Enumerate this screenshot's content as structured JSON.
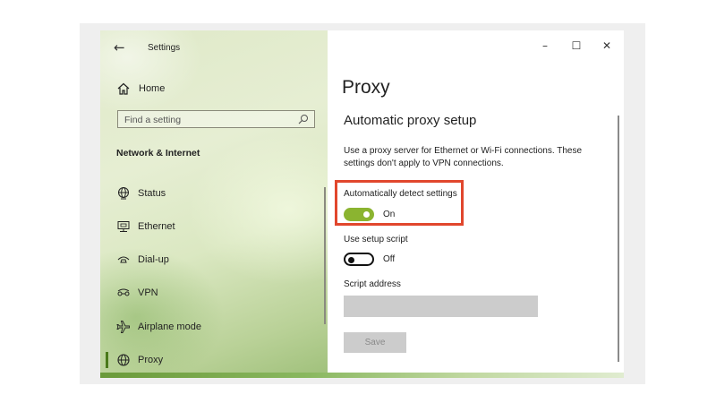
{
  "window": {
    "app_title": "Settings",
    "controls": {
      "minimize": "–",
      "maximize": "☐",
      "close": "✕"
    }
  },
  "sidebar": {
    "home_label": "Home",
    "search_placeholder": "Find a setting",
    "section_header": "Network & Internet",
    "items": [
      {
        "label": "Status",
        "icon": "globe-status-icon"
      },
      {
        "label": "Ethernet",
        "icon": "ethernet-monitor-icon"
      },
      {
        "label": "Dial-up",
        "icon": "dialup-phone-icon"
      },
      {
        "label": "VPN",
        "icon": "vpn-icon"
      },
      {
        "label": "Airplane mode",
        "icon": "airplane-icon"
      },
      {
        "label": "Proxy",
        "icon": "globe-proxy-icon",
        "selected": true
      }
    ]
  },
  "main": {
    "page_title": "Proxy",
    "section_title": "Automatic proxy setup",
    "description": "Use a proxy server for Ethernet or Wi-Fi connections. These settings don't apply to VPN connections.",
    "auto_detect": {
      "label": "Automatically detect settings",
      "state": "On",
      "on": true
    },
    "setup_script": {
      "label": "Use setup script",
      "state": "Off",
      "on": false
    },
    "script_address": {
      "label": "Script address",
      "value": ""
    },
    "save_label": "Save"
  },
  "colors": {
    "toggle_on": "#8bb430",
    "highlight_border": "#e1472d",
    "sidebar_selected": "#4a7a1a"
  }
}
